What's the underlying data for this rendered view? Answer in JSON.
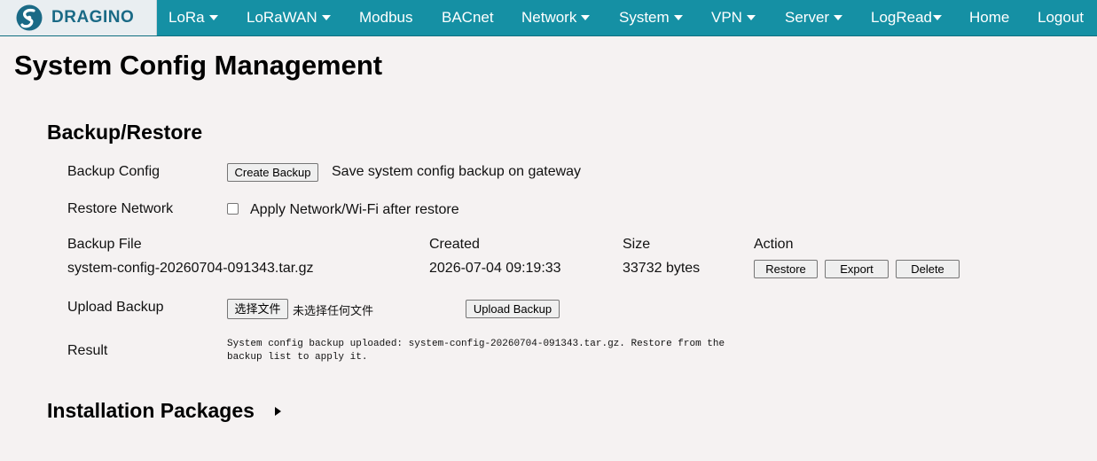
{
  "brand": {
    "logo_text": "DRAGINO",
    "nav_color": "#1590a4"
  },
  "nav": {
    "lora": "LoRa",
    "lorawan": "LoRaWAN",
    "modbus": "Modbus",
    "bacnet": "BACnet",
    "network": "Network",
    "system": "System",
    "vpn": "VPN",
    "server": "Server",
    "logread": "LogRead",
    "home": "Home",
    "logout": "Logout"
  },
  "page": {
    "title": "System Config Management"
  },
  "backup_restore": {
    "heading": "Backup/Restore",
    "backup_config_label": "Backup Config",
    "create_backup_button": "Create Backup",
    "create_backup_desc": "Save system config backup on gateway",
    "restore_network_label": "Restore Network",
    "apply_network_checked": false,
    "apply_network_text": "Apply Network/Wi-Fi after restore",
    "table": {
      "headers": {
        "file": "Backup File",
        "created": "Created",
        "size": "Size",
        "action": "Action"
      },
      "rows": [
        {
          "file": "system-config-20260704-091343.tar.gz",
          "created": "2026-07-04 09:19:33",
          "size": "33732 bytes",
          "restore": "Restore",
          "export": "Export",
          "delete": "Delete"
        }
      ]
    },
    "upload_backup_label": "Upload Backup",
    "choose_file_button": "选择文件",
    "no_file_text": "未选择任何文件",
    "upload_backup_button": "Upload Backup",
    "result_label": "Result",
    "result_text": "System config backup uploaded: system-config-20260704-091343.tar.gz. Restore from the backup list to apply it."
  },
  "installation_packages": {
    "heading": "Installation Packages"
  }
}
